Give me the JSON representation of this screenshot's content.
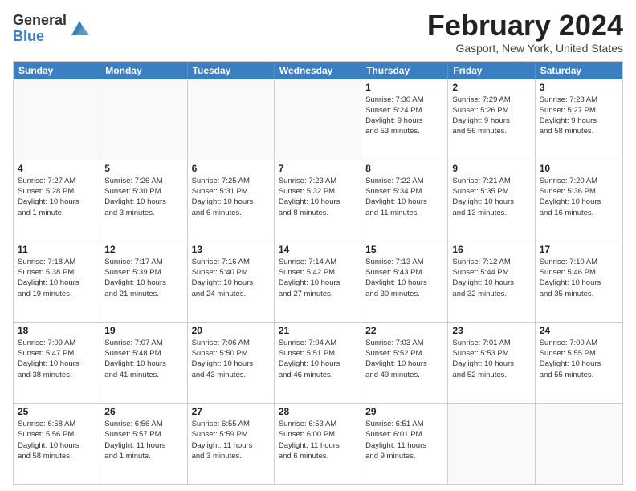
{
  "header": {
    "logo_general": "General",
    "logo_blue": "Blue",
    "month_title": "February 2024",
    "location": "Gasport, New York, United States"
  },
  "days_of_week": [
    "Sunday",
    "Monday",
    "Tuesday",
    "Wednesday",
    "Thursday",
    "Friday",
    "Saturday"
  ],
  "weeks": [
    [
      {
        "day": "",
        "info": ""
      },
      {
        "day": "",
        "info": ""
      },
      {
        "day": "",
        "info": ""
      },
      {
        "day": "",
        "info": ""
      },
      {
        "day": "1",
        "info": "Sunrise: 7:30 AM\nSunset: 5:24 PM\nDaylight: 9 hours\nand 53 minutes."
      },
      {
        "day": "2",
        "info": "Sunrise: 7:29 AM\nSunset: 5:26 PM\nDaylight: 9 hours\nand 56 minutes."
      },
      {
        "day": "3",
        "info": "Sunrise: 7:28 AM\nSunset: 5:27 PM\nDaylight: 9 hours\nand 58 minutes."
      }
    ],
    [
      {
        "day": "4",
        "info": "Sunrise: 7:27 AM\nSunset: 5:28 PM\nDaylight: 10 hours\nand 1 minute."
      },
      {
        "day": "5",
        "info": "Sunrise: 7:26 AM\nSunset: 5:30 PM\nDaylight: 10 hours\nand 3 minutes."
      },
      {
        "day": "6",
        "info": "Sunrise: 7:25 AM\nSunset: 5:31 PM\nDaylight: 10 hours\nand 6 minutes."
      },
      {
        "day": "7",
        "info": "Sunrise: 7:23 AM\nSunset: 5:32 PM\nDaylight: 10 hours\nand 8 minutes."
      },
      {
        "day": "8",
        "info": "Sunrise: 7:22 AM\nSunset: 5:34 PM\nDaylight: 10 hours\nand 11 minutes."
      },
      {
        "day": "9",
        "info": "Sunrise: 7:21 AM\nSunset: 5:35 PM\nDaylight: 10 hours\nand 13 minutes."
      },
      {
        "day": "10",
        "info": "Sunrise: 7:20 AM\nSunset: 5:36 PM\nDaylight: 10 hours\nand 16 minutes."
      }
    ],
    [
      {
        "day": "11",
        "info": "Sunrise: 7:18 AM\nSunset: 5:38 PM\nDaylight: 10 hours\nand 19 minutes."
      },
      {
        "day": "12",
        "info": "Sunrise: 7:17 AM\nSunset: 5:39 PM\nDaylight: 10 hours\nand 21 minutes."
      },
      {
        "day": "13",
        "info": "Sunrise: 7:16 AM\nSunset: 5:40 PM\nDaylight: 10 hours\nand 24 minutes."
      },
      {
        "day": "14",
        "info": "Sunrise: 7:14 AM\nSunset: 5:42 PM\nDaylight: 10 hours\nand 27 minutes."
      },
      {
        "day": "15",
        "info": "Sunrise: 7:13 AM\nSunset: 5:43 PM\nDaylight: 10 hours\nand 30 minutes."
      },
      {
        "day": "16",
        "info": "Sunrise: 7:12 AM\nSunset: 5:44 PM\nDaylight: 10 hours\nand 32 minutes."
      },
      {
        "day": "17",
        "info": "Sunrise: 7:10 AM\nSunset: 5:46 PM\nDaylight: 10 hours\nand 35 minutes."
      }
    ],
    [
      {
        "day": "18",
        "info": "Sunrise: 7:09 AM\nSunset: 5:47 PM\nDaylight: 10 hours\nand 38 minutes."
      },
      {
        "day": "19",
        "info": "Sunrise: 7:07 AM\nSunset: 5:48 PM\nDaylight: 10 hours\nand 41 minutes."
      },
      {
        "day": "20",
        "info": "Sunrise: 7:06 AM\nSunset: 5:50 PM\nDaylight: 10 hours\nand 43 minutes."
      },
      {
        "day": "21",
        "info": "Sunrise: 7:04 AM\nSunset: 5:51 PM\nDaylight: 10 hours\nand 46 minutes."
      },
      {
        "day": "22",
        "info": "Sunrise: 7:03 AM\nSunset: 5:52 PM\nDaylight: 10 hours\nand 49 minutes."
      },
      {
        "day": "23",
        "info": "Sunrise: 7:01 AM\nSunset: 5:53 PM\nDaylight: 10 hours\nand 52 minutes."
      },
      {
        "day": "24",
        "info": "Sunrise: 7:00 AM\nSunset: 5:55 PM\nDaylight: 10 hours\nand 55 minutes."
      }
    ],
    [
      {
        "day": "25",
        "info": "Sunrise: 6:58 AM\nSunset: 5:56 PM\nDaylight: 10 hours\nand 58 minutes."
      },
      {
        "day": "26",
        "info": "Sunrise: 6:56 AM\nSunset: 5:57 PM\nDaylight: 11 hours\nand 1 minute."
      },
      {
        "day": "27",
        "info": "Sunrise: 6:55 AM\nSunset: 5:59 PM\nDaylight: 11 hours\nand 3 minutes."
      },
      {
        "day": "28",
        "info": "Sunrise: 6:53 AM\nSunset: 6:00 PM\nDaylight: 11 hours\nand 6 minutes."
      },
      {
        "day": "29",
        "info": "Sunrise: 6:51 AM\nSunset: 6:01 PM\nDaylight: 11 hours\nand 9 minutes."
      },
      {
        "day": "",
        "info": ""
      },
      {
        "day": "",
        "info": ""
      }
    ]
  ]
}
